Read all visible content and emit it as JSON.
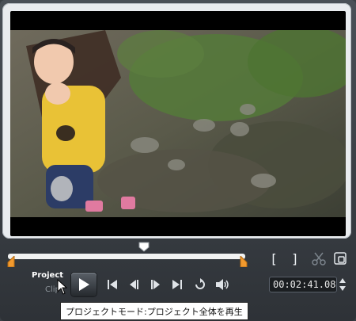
{
  "playback": {
    "mode_project": "Project",
    "mode_clip": "Clip"
  },
  "timecode": "00:02:41.08",
  "tooltip": "プロジェクトモード:プロジェクト全体を再生",
  "trim_in_label": "[",
  "trim_out_label": "]",
  "colors": {
    "accent_orange": "#f29a2e",
    "panel": "#3a3f44"
  },
  "icons": [
    "play-icon",
    "go-to-start-icon",
    "previous-frame-icon",
    "next-frame-icon",
    "go-to-end-icon",
    "repeat-icon",
    "volume-icon",
    "split-clip-icon",
    "enlarge-preview-icon"
  ]
}
